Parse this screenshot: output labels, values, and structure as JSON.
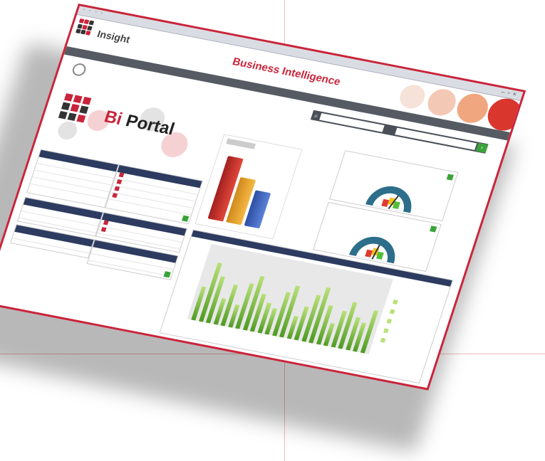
{
  "window": {
    "title_fragment": "Business Intelligence"
  },
  "header": {
    "brand": "Insight",
    "app_title": "Business Intelligence"
  },
  "menu": {
    "items": [
      "",
      "",
      "",
      ""
    ]
  },
  "portal": {
    "title_prefix": "Bi",
    "title_rest": "Portal"
  },
  "colors": {
    "accent": "#c9243a",
    "navy": "#2c3b5f",
    "green": "#3aa33a"
  },
  "icons": [
    "clock-icon",
    "search-icon",
    "go-icon",
    "window-controls-icon"
  ]
}
